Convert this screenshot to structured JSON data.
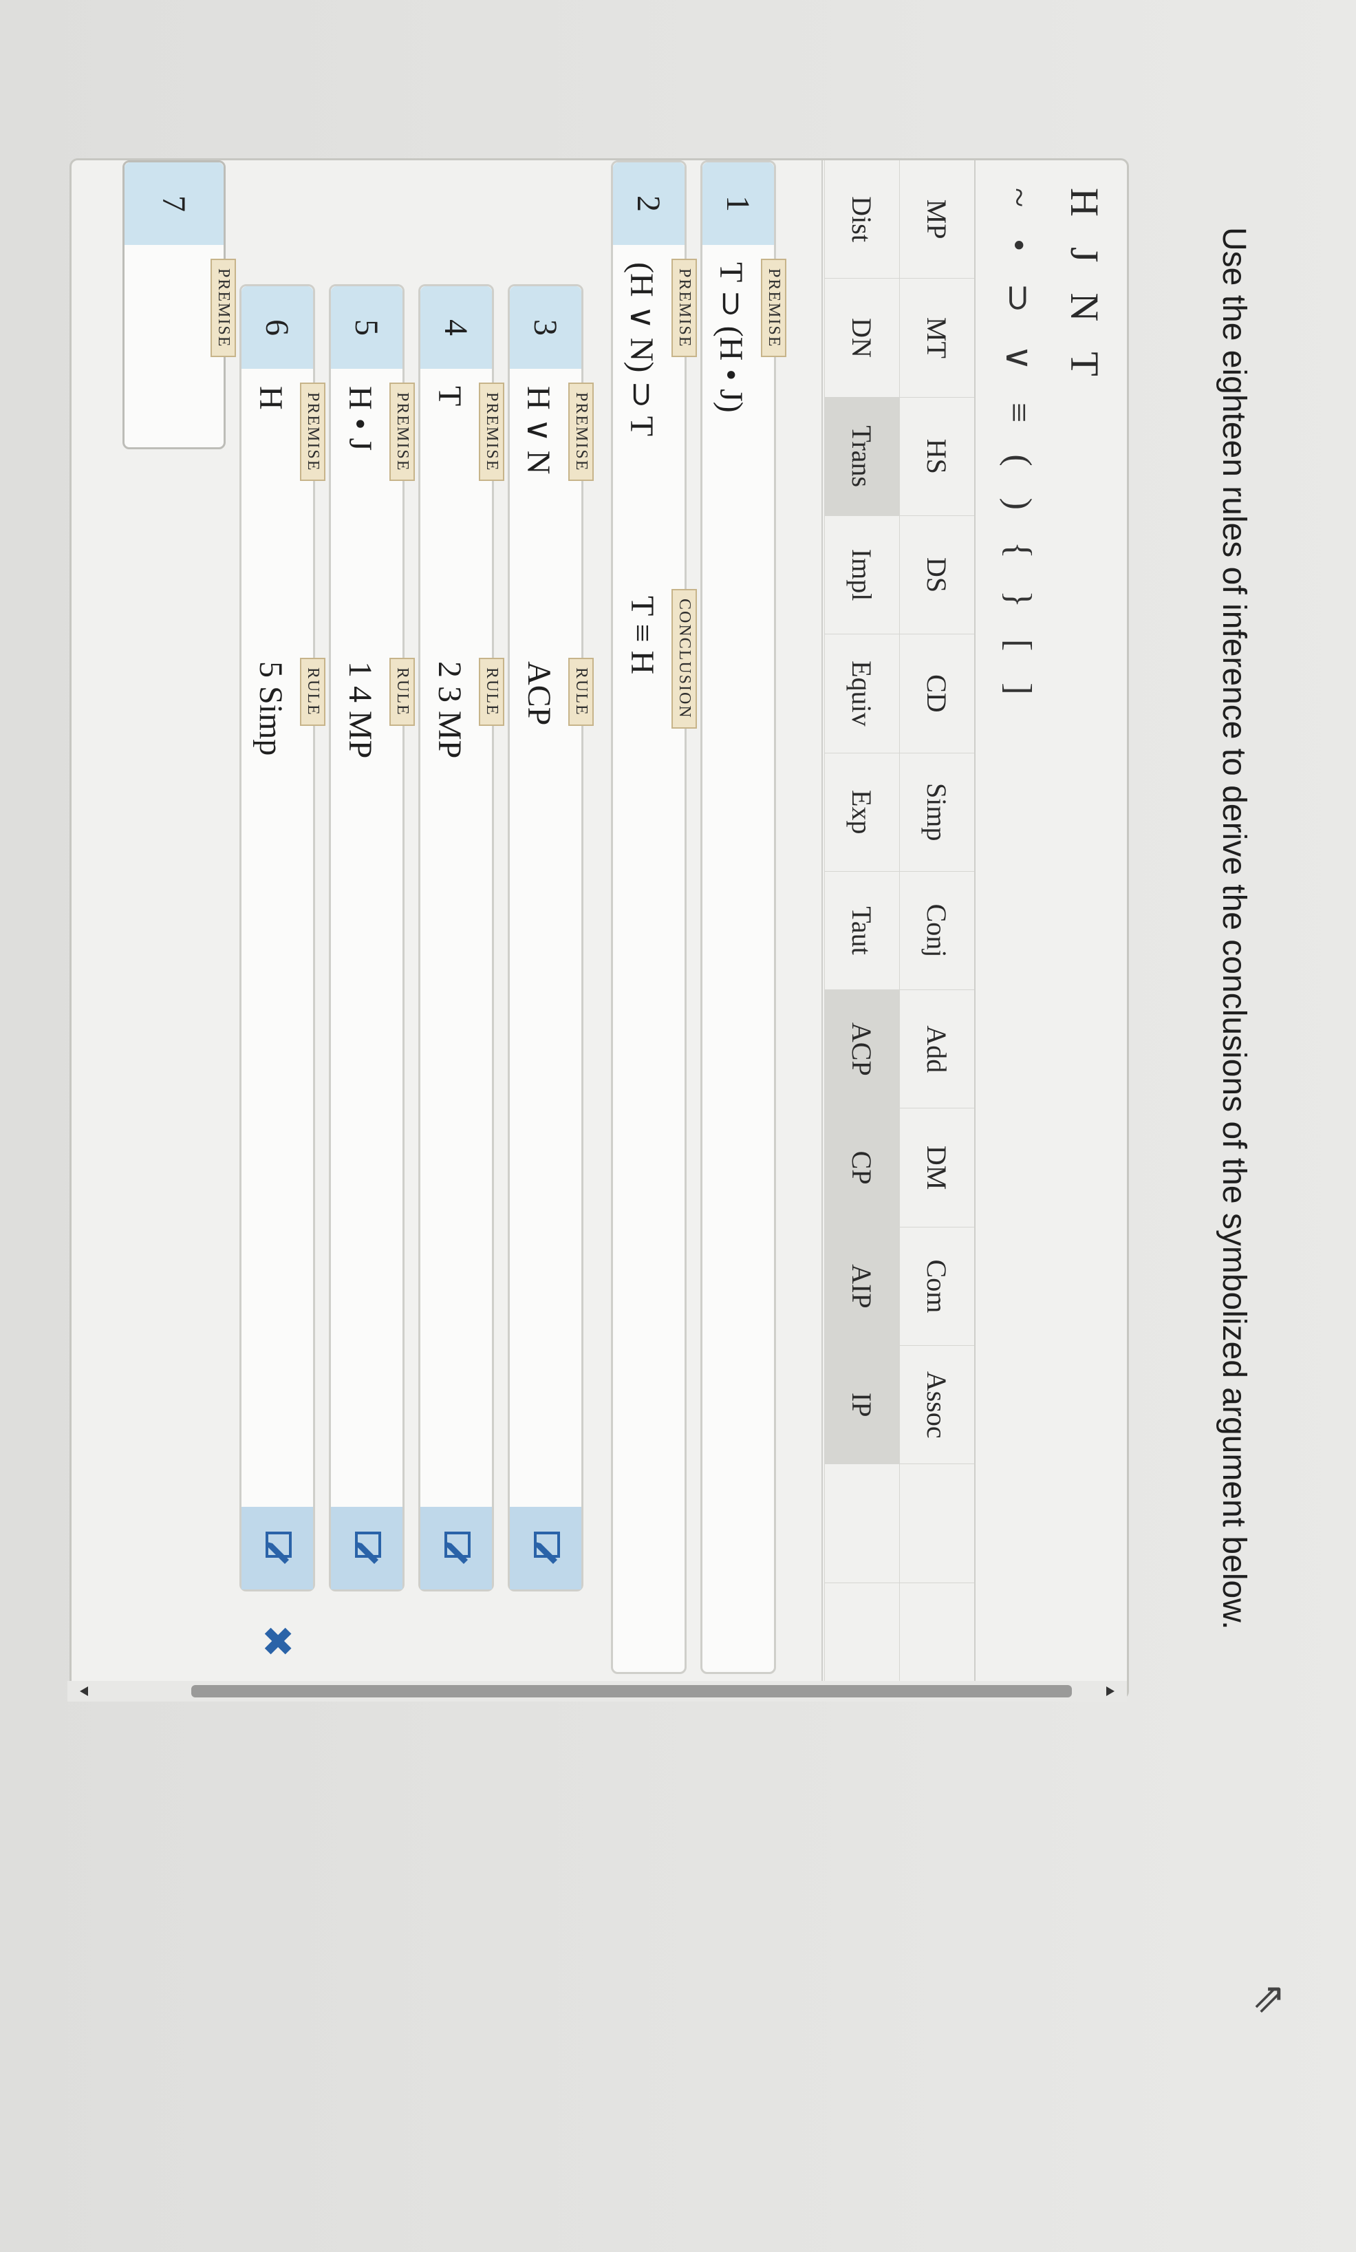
{
  "instruction": "Use the eighteen rules of inference to derive the conclusions of the symbolized argument below.",
  "variables": [
    "H",
    "J",
    "N",
    "T"
  ],
  "symbols": [
    "~",
    "•",
    "⊃",
    "∨",
    "≡",
    "(",
    ")",
    "{",
    "}",
    "[",
    "]"
  ],
  "rules_row1": [
    "MP",
    "MT",
    "HS",
    "DS",
    "CD",
    "Simp",
    "Conj",
    "Add",
    "DM",
    "Com",
    "Assoc"
  ],
  "rules_row2": [
    "Dist",
    "DN",
    "Trans",
    "Impl",
    "Equiv",
    "Exp",
    "Taut",
    "ACP",
    "CP",
    "AIP",
    "IP"
  ],
  "highlighted_rules": [
    "Trans",
    "ACP",
    "CP",
    "AIP",
    "IP"
  ],
  "lines": [
    {
      "number": "1",
      "tag": "PREMISE",
      "formula": "T ⊃ (H • J)"
    },
    {
      "number": "2",
      "tag": "PREMISE",
      "formula": "(H ∨ N) ⊃ T",
      "conclusion_tag": "CONCLUSION",
      "conclusion": "T ≡ H"
    },
    {
      "number": "3",
      "tag": "PREMISE",
      "formula": "H ∨ N",
      "rule_tag": "RULE",
      "rule": "ACP"
    },
    {
      "number": "4",
      "tag": "PREMISE",
      "formula": "T",
      "rule_tag": "RULE",
      "rule": "2 3 MP"
    },
    {
      "number": "5",
      "tag": "PREMISE",
      "formula": "H • J",
      "rule_tag": "RULE",
      "rule": "1 4 MP"
    },
    {
      "number": "6",
      "tag": "PREMISE",
      "formula": "H",
      "rule_tag": "RULE",
      "rule": "5 Simp"
    },
    {
      "number": "7",
      "tag": "PREMISE",
      "formula": ""
    }
  ],
  "colors": {
    "line_number_bg": "#cde3ef",
    "tag_bg": "#efe4c8",
    "edit_bg": "#bfd8ea",
    "delete_color": "#2a63a8"
  },
  "icons": {
    "edit": "pencil-edit-icon",
    "delete": "x-close-icon",
    "cursor": "mouse-pointer-icon"
  }
}
